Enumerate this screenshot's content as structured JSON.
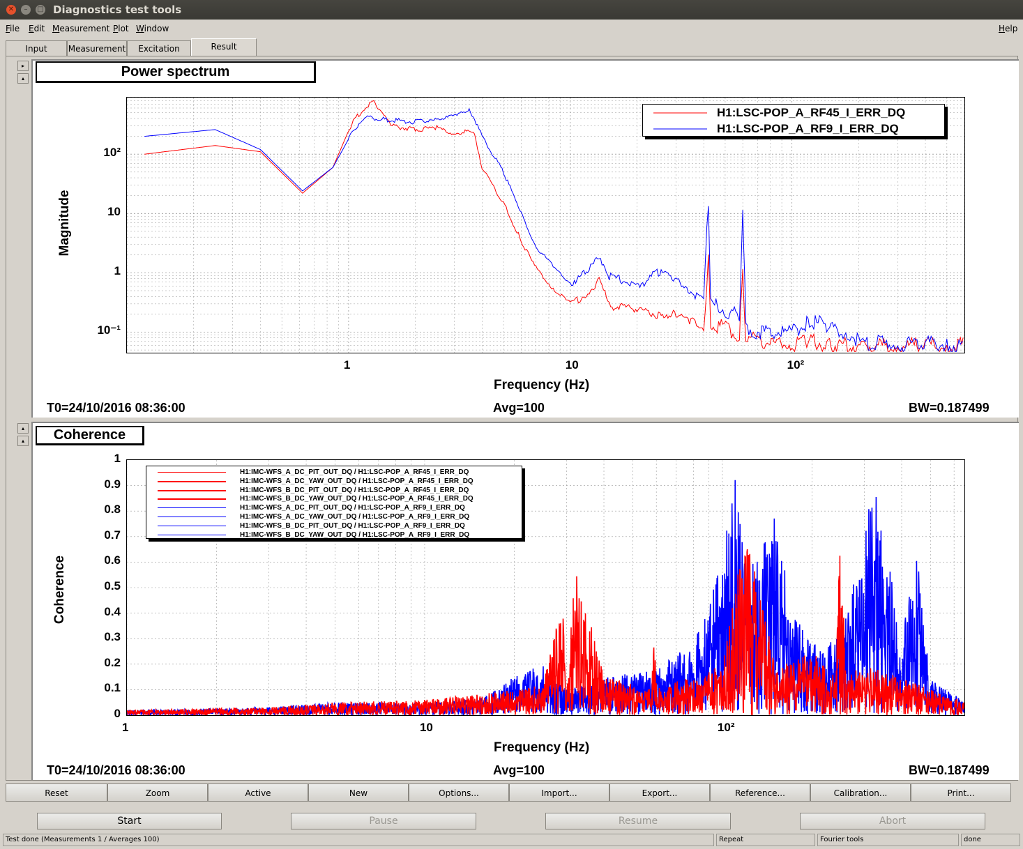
{
  "window": {
    "title": "Diagnostics test tools"
  },
  "menu": {
    "file": "File",
    "edit": "Edit",
    "measurement": "Measurement",
    "plot": "Plot",
    "window": "Window",
    "help": "Help"
  },
  "tabs": [
    "Input",
    "Measurement",
    "Excitation",
    "Result"
  ],
  "panel1": {
    "title": "Power spectrum",
    "t0": "T0=24/10/2016 08:36:00",
    "avg": "Avg=100",
    "bw": "BW=0.187499"
  },
  "panel2": {
    "title": "Coherence",
    "t0": "T0=24/10/2016 08:36:00",
    "avg": "Avg=100",
    "bw": "BW=0.187499"
  },
  "buttons": [
    "Reset",
    "Zoom",
    "Active",
    "New",
    "Options...",
    "Import...",
    "Export...",
    "Reference...",
    "Calibration...",
    "Print..."
  ],
  "controls": {
    "start": "Start",
    "pause": "Pause",
    "resume": "Resume",
    "abort": "Abort"
  },
  "status": {
    "main": "Test done (Measurements 1 / Averages 100)",
    "repeat": "Repeat",
    "fourier": "Fourier tools",
    "state": "done"
  },
  "colors": {
    "red": "#ff0000",
    "blue": "#0000ff"
  },
  "chart_data": [
    {
      "type": "line",
      "title": "Power spectrum",
      "xlabel": "Frequency (Hz)",
      "ylabel": "Magnitude",
      "xscale": "log",
      "yscale": "log",
      "xlim": [
        0.1,
        600
      ],
      "ylim": [
        0.045,
        900
      ],
      "xticks": [
        "1",
        "10",
        "10²"
      ],
      "yticks": [
        "10⁻¹",
        "1",
        "10",
        "10²"
      ],
      "grid": true,
      "legend_position": "top-right",
      "series": [
        {
          "name": "H1:LSC-POP_A_RF45_I_ERR_DQ",
          "color": "#ff0000",
          "x": [
            0.12,
            0.25,
            0.4,
            0.62,
            0.85,
            1.05,
            1.3,
            1.55,
            2.0,
            2.5,
            3.0,
            3.5,
            3.7,
            4.0,
            5.0,
            6.0,
            7.0,
            8.5,
            10,
            12,
            13.5,
            15,
            20,
            25,
            30,
            35,
            40,
            42,
            43,
            48,
            55,
            58,
            60,
            62,
            70,
            100,
            120,
            150,
            200,
            300,
            400,
            500,
            600
          ],
          "y": [
            100,
            140,
            110,
            22,
            60,
            380,
            800,
            300,
            260,
            280,
            220,
            250,
            210,
            60,
            15,
            3.5,
            1.2,
            0.5,
            0.3,
            0.45,
            0.8,
            0.28,
            0.25,
            0.2,
            0.2,
            0.16,
            0.13,
            1.5,
            0.13,
            0.12,
            0.1,
            0.09,
            0.9,
            0.08,
            0.07,
            0.06,
            0.07,
            0.06,
            0.058,
            0.058,
            0.06,
            0.057,
            0.06
          ]
        },
        {
          "name": "H1:LSC-POP_A_RF9_I_ERR_DQ",
          "color": "#0000ff",
          "x": [
            0.12,
            0.25,
            0.4,
            0.62,
            0.85,
            1.05,
            1.2,
            1.5,
            2.0,
            2.5,
            3.0,
            3.5,
            3.7,
            4.0,
            5.0,
            6.0,
            7.0,
            8.5,
            10,
            12,
            13.5,
            15,
            20,
            25,
            30,
            35,
            40,
            42,
            43,
            48,
            55,
            58,
            60,
            62,
            70,
            100,
            120,
            150,
            180,
            200,
            300,
            400,
            500,
            600
          ],
          "y": [
            200,
            260,
            120,
            24,
            60,
            250,
            420,
            380,
            350,
            400,
            430,
            550,
            400,
            200,
            50,
            10,
            2.8,
            1.2,
            0.7,
            1.0,
            2.0,
            0.9,
            0.6,
            1.0,
            0.8,
            0.5,
            0.32,
            18,
            0.3,
            0.25,
            0.2,
            0.15,
            15,
            0.12,
            0.1,
            0.1,
            0.16,
            0.12,
            0.1,
            0.07,
            0.06,
            0.07,
            0.06,
            0.06
          ]
        }
      ]
    },
    {
      "type": "line",
      "title": "Coherence",
      "xlabel": "Frequency (Hz)",
      "ylabel": "Coherence",
      "xscale": "log",
      "xlim": [
        1,
        650
      ],
      "ylim": [
        0,
        1
      ],
      "xticks": [
        "1",
        "10",
        "10²"
      ],
      "yticks": [
        "0",
        "0.1",
        "0.2",
        "0.3",
        "0.4",
        "0.5",
        "0.6",
        "0.7",
        "0.8",
        "0.9",
        "1"
      ],
      "grid": true,
      "legend_position": "top-left",
      "series": [
        {
          "name": "H1:IMC-WFS_A_DC_PIT_OUT_DQ / H1:LSC-POP_A_RF45_I_ERR_DQ",
          "color": "#ff0000"
        },
        {
          "name": "H1:IMC-WFS_A_DC_YAW_OUT_DQ / H1:LSC-POP_A_RF45_I_ERR_DQ",
          "color": "#ff0000"
        },
        {
          "name": "H1:IMC-WFS_B_DC_PIT_OUT_DQ / H1:LSC-POP_A_RF45_I_ERR_DQ",
          "color": "#ff0000"
        },
        {
          "name": "H1:IMC-WFS_B_DC_YAW_OUT_DQ / H1:LSC-POP_A_RF45_I_ERR_DQ",
          "color": "#ff0000"
        },
        {
          "name": "H1:IMC-WFS_A_DC_PIT_OUT_DQ / H1:LSC-POP_A_RF9_I_ERR_DQ",
          "color": "#0000ff"
        },
        {
          "name": "H1:IMC-WFS_A_DC_YAW_OUT_DQ / H1:LSC-POP_A_RF9_I_ERR_DQ",
          "color": "#0000ff"
        },
        {
          "name": "H1:IMC-WFS_B_DC_PIT_OUT_DQ / H1:LSC-POP_A_RF9_I_ERR_DQ",
          "color": "#0000ff"
        },
        {
          "name": "H1:IMC-WFS_B_DC_YAW_OUT_DQ / H1:LSC-POP_A_RF9_I_ERR_DQ",
          "color": "#0000ff"
        }
      ],
      "envelope": {
        "red": {
          "x": [
            1,
            3,
            5,
            10,
            15,
            20,
            25,
            29,
            30,
            32,
            40,
            58,
            59,
            60,
            80,
            100,
            120,
            150,
            200,
            240,
            250,
            260,
            300,
            400,
            500,
            650
          ],
          "y": [
            0.02,
            0.03,
            0.05,
            0.06,
            0.08,
            0.1,
            0.12,
            0.45,
            0.1,
            0.6,
            0.15,
            0.1,
            0.87,
            0.12,
            0.15,
            0.2,
            0.75,
            0.2,
            0.25,
            0.15,
            0.79,
            0.15,
            0.2,
            0.15,
            0.1,
            0.05
          ]
        },
        "blue": {
          "x": [
            1,
            3,
            5,
            10,
            15,
            20,
            25,
            30,
            40,
            60,
            80,
            100,
            110,
            120,
            130,
            150,
            170,
            200,
            250,
            300,
            320,
            350,
            400,
            450,
            500,
            650
          ],
          "y": [
            0.02,
            0.03,
            0.05,
            0.05,
            0.06,
            0.15,
            0.2,
            0.1,
            0.15,
            0.18,
            0.3,
            0.6,
            0.98,
            0.6,
            0.6,
            0.84,
            0.4,
            0.3,
            0.3,
            0.7,
            0.93,
            0.7,
            0.3,
            0.65,
            0.15,
            0.05
          ]
        }
      }
    }
  ]
}
